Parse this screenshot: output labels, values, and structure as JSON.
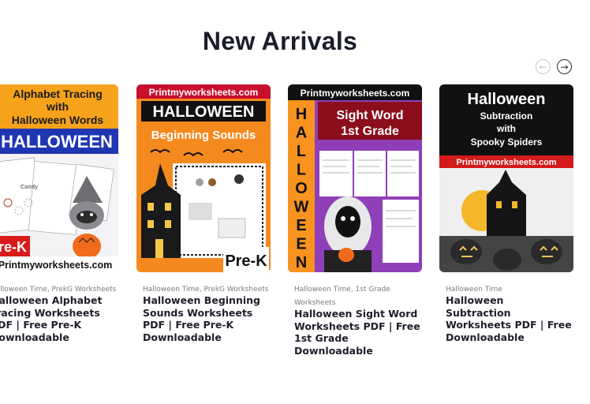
{
  "section_title": "New Arrivals",
  "nav": {
    "prev_icon": "arrow-left-icon",
    "next_icon": "arrow-right-icon"
  },
  "products": [
    {
      "categories": "Halloween Time, PrekG Worksheets",
      "name": "Halloween Alphabet Tracing Worksheets PDF | Free Pre-K Downloadable",
      "thumb": {
        "line1": "Alphabet Tracing",
        "line2": "with",
        "line3": "Halloween Words",
        "banner": "HALLOWEEN",
        "badge": "Pre-K",
        "site": "Printmyworksheets.com",
        "sheet_word": "Candy"
      }
    },
    {
      "categories": "Halloween Time, PrekG Worksheets",
      "name": "Halloween Beginning Sounds Worksheets PDF | Free Pre-K Downloadable",
      "thumb": {
        "site": "Printmyworksheets.com",
        "title": "HALLOWEEN",
        "subtitle": "Beginning Sounds",
        "badge": "Pre-K"
      }
    },
    {
      "categories": "Halloween Time, 1st Grade Worksheets",
      "name": "Halloween Sight Word Worksheets PDF | Free 1st Grade Downloadable",
      "thumb": {
        "site": "Printmyworksheets.com",
        "vertical": "HALLOWEEN",
        "title1": "Sight Word",
        "title2": "1st Grade"
      }
    },
    {
      "categories": "Halloween Time",
      "name": "Halloween Subtraction Worksheets PDF | Free Downloadable",
      "thumb": {
        "title": "Halloween",
        "sub1": "Subtraction",
        "sub2": "with",
        "sub3": "Spooky Spiders",
        "site": "Printmyworksheets.com"
      }
    }
  ],
  "colors": {
    "title": "#1b1d2a",
    "orange": "#f7931e",
    "purple": "#8e44ad",
    "red": "#c8102e"
  }
}
